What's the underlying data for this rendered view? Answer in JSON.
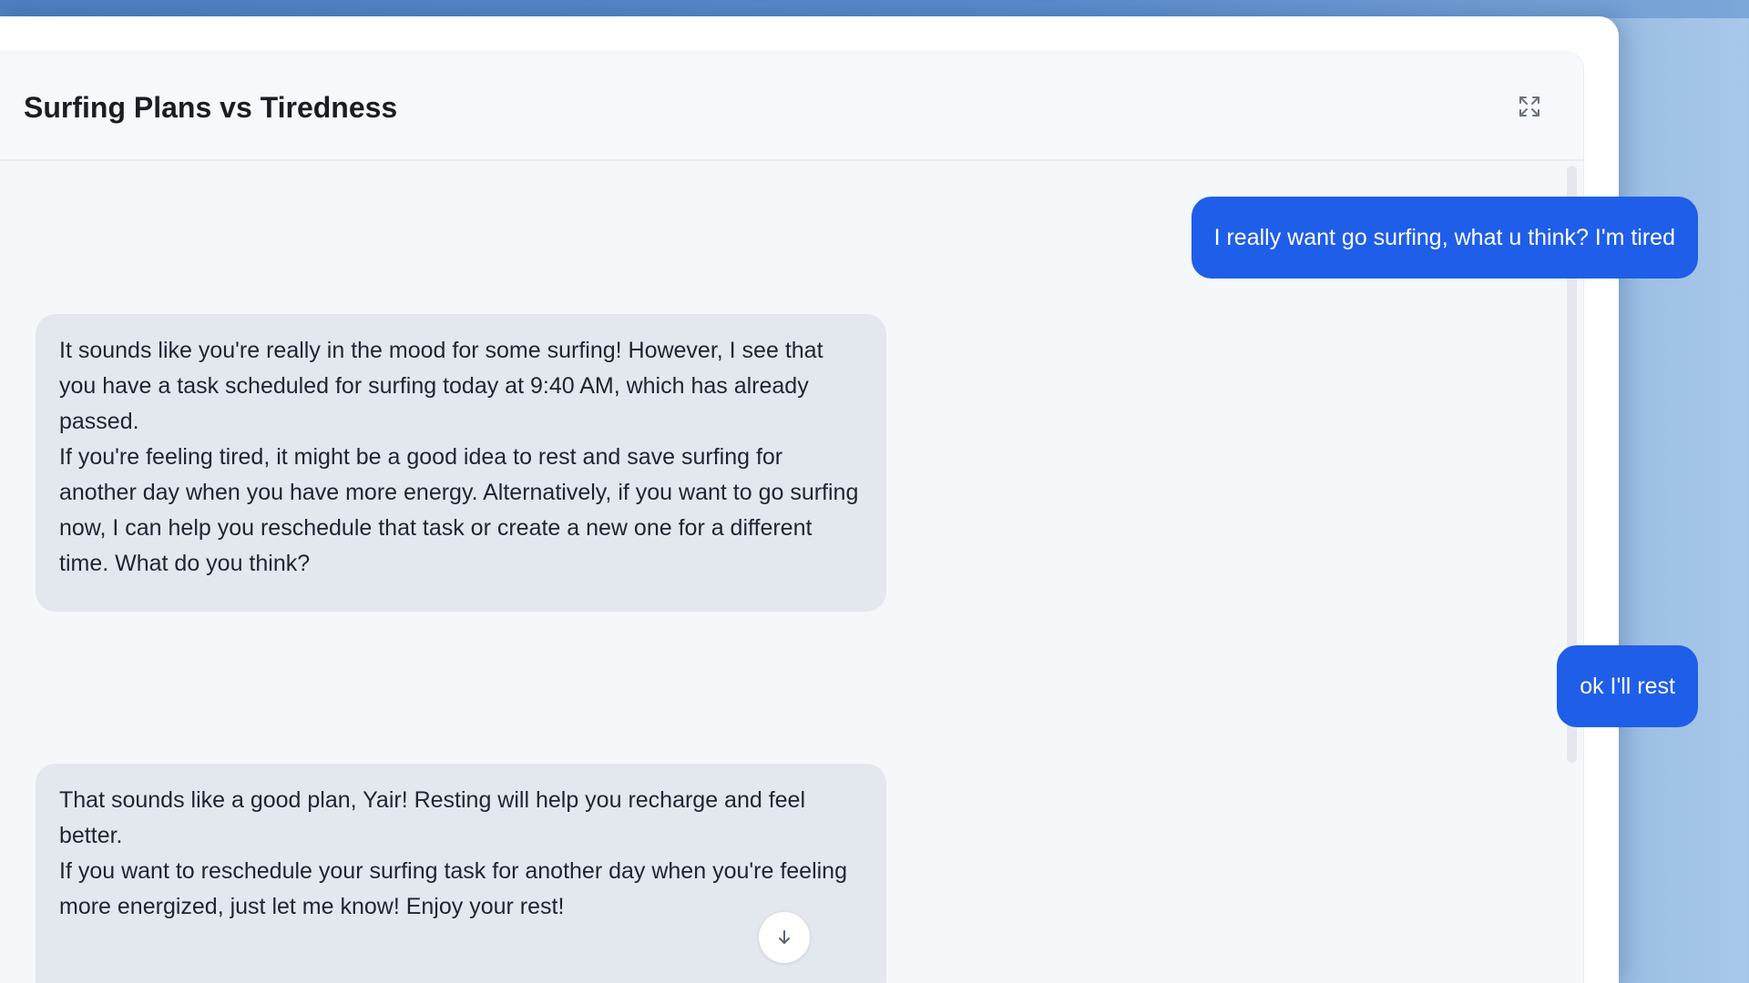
{
  "chat": {
    "title": "Surfing Plans vs Tiredness",
    "messages": [
      {
        "role": "user",
        "text": "I really want go surfing, what u think? I'm tired"
      },
      {
        "role": "assistant",
        "paragraphs": [
          "It sounds like you're really in the mood for some surfing! However, I see that you have a task scheduled for surfing today at 9:40 AM, which has already passed.",
          "If you're feeling tired, it might be a good idea to rest and save surfing for another day when you have more energy. Alternatively, if you want to go surfing now, I can help you reschedule that task or create a new one for a different time. What do you think?"
        ]
      },
      {
        "role": "user",
        "text": "ok I'll rest"
      },
      {
        "role": "assistant",
        "paragraphs": [
          "That sounds like a good plan, Yair! Resting will help you recharge and feel better.",
          "If you want to reschedule your surfing task for another day when you're feeling more energized, just let me know! Enjoy your rest!"
        ]
      }
    ]
  },
  "icons": {
    "expand": "expand-icon",
    "scroll_down": "arrow-down-icon"
  },
  "colors": {
    "user_bubble": "#1f5ee8",
    "assistant_bubble": "#e3e8ef",
    "panel_background": "#f5f8fb"
  }
}
